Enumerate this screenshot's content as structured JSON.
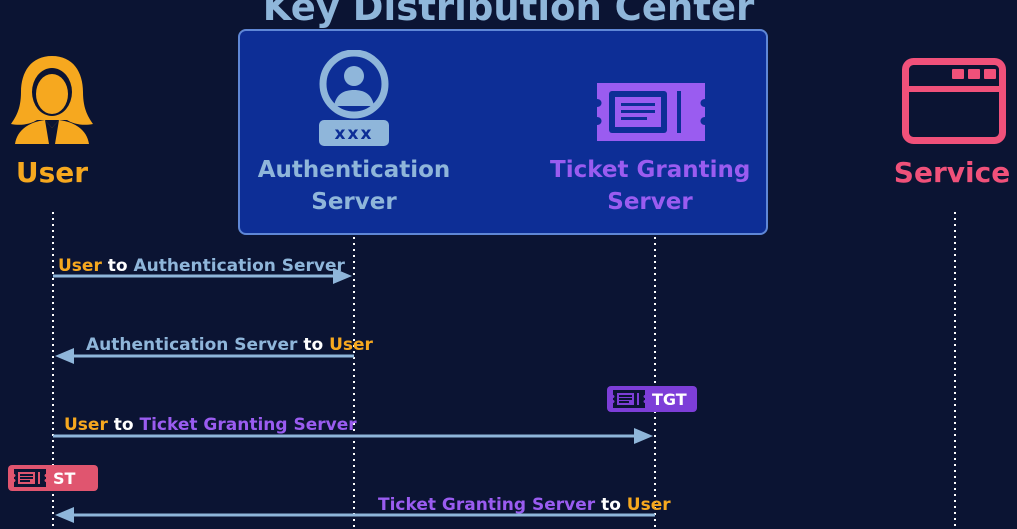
{
  "title": "Key Distribution Center",
  "actors": {
    "user": {
      "label": "User",
      "icon": "user-icon"
    },
    "authentication_server": {
      "line1": "Authentication",
      "line2": "Server",
      "icon": "authentication-server-icon"
    },
    "ticket_granting_server": {
      "line1": "Ticket Granting",
      "line2": "Server",
      "icon": "ticket-icon"
    },
    "service": {
      "label": "Service",
      "icon": "browser-window-icon"
    }
  },
  "messages": [
    {
      "from_label": "User",
      "connector": "to",
      "to_label": "Authentication Server",
      "direction": "right"
    },
    {
      "from_label": "Authentication Server",
      "connector": "to",
      "to_label": "User",
      "direction": "left"
    },
    {
      "from_label": "User",
      "connector": "to",
      "to_label": "Ticket Granting Server",
      "direction": "right"
    },
    {
      "from_label": "Ticket Granting Server",
      "connector": "to",
      "to_label": "User",
      "direction": "left"
    }
  ],
  "badges": {
    "tgt": {
      "label": "TGT",
      "icon": "ticket-icon"
    },
    "st": {
      "label": "ST",
      "icon": "ticket-icon"
    }
  },
  "colors": {
    "background": "#0b1433",
    "kdc_box": "#0d2e96",
    "user": "#f6a81f",
    "authentication_server": "#8fb6da",
    "ticket_granting_server": "#9a5cf0",
    "service": "#f0517a",
    "arrow": "#8fb6da",
    "lifeline": "#ffffff"
  }
}
